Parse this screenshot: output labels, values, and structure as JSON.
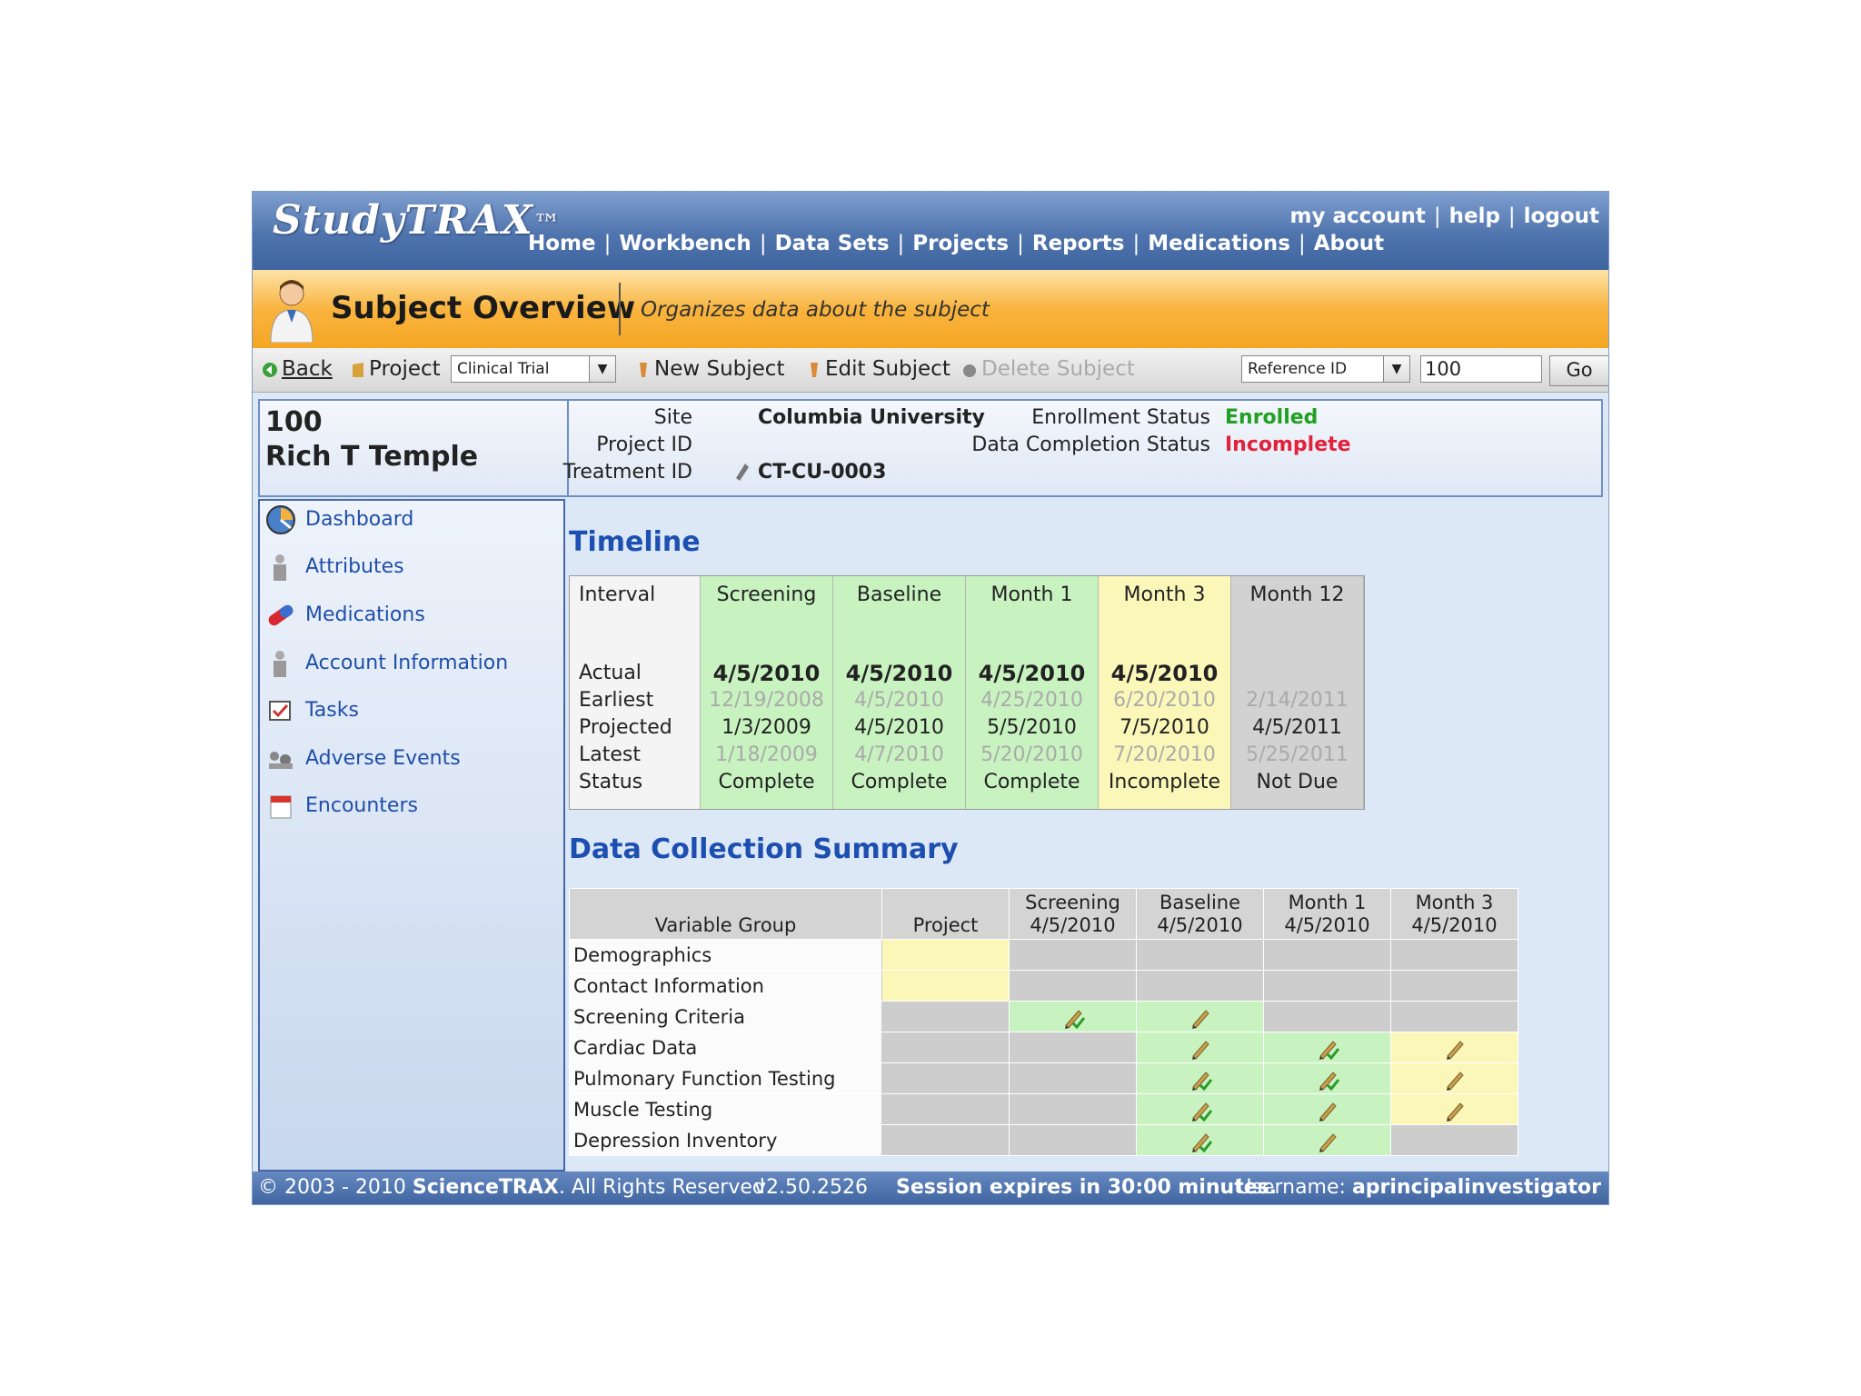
{
  "header": {
    "logo_text": "StudyTRAX",
    "logo_tm": "™",
    "nav": [
      "Home",
      "Workbench",
      "Data Sets",
      "Projects",
      "Reports",
      "Medications",
      "About"
    ],
    "user_nav": [
      "my account",
      "help",
      "logout"
    ],
    "colors": {
      "header": "#4f74ad",
      "title_bar": "#f9b43f"
    }
  },
  "title_bar": {
    "title": "Subject Overview",
    "subtitle": "Organizes data about the subject"
  },
  "toolbar": {
    "back": "Back",
    "project_label": "Project",
    "project_value": "Clinical Trial",
    "new_subject": "New Subject",
    "edit_subject": "Edit Subject",
    "delete_subject": "Delete Subject",
    "reference_select": "Reference ID",
    "reference_value": "100",
    "go": "Go"
  },
  "subject": {
    "id": "100",
    "name": "Rich T Temple",
    "site_label": "Site",
    "site": "Columbia University",
    "project_id_label": "Project ID",
    "project_id": "",
    "treatment_id_label": "Treatment ID",
    "treatment_id": "CT-CU-0003",
    "enrollment_label": "Enrollment Status",
    "enrollment": "Enrolled",
    "completion_label": "Data Completion Status",
    "completion": "Incomplete"
  },
  "sidebar": {
    "items": [
      {
        "label": "Dashboard",
        "icon": "dashboard-icon"
      },
      {
        "label": "Attributes",
        "icon": "attributes-icon"
      },
      {
        "label": "Medications",
        "icon": "pill-icon"
      },
      {
        "label": "Account Information",
        "icon": "account-icon"
      },
      {
        "label": "Tasks",
        "icon": "checkbox-icon"
      },
      {
        "label": "Adverse Events",
        "icon": "adverse-events-icon"
      },
      {
        "label": "Encounters",
        "icon": "calendar-icon"
      }
    ]
  },
  "timeline": {
    "title": "Timeline",
    "row_labels": [
      "Interval",
      "Actual",
      "Earliest",
      "Projected",
      "Latest",
      "Status"
    ],
    "columns": [
      {
        "interval": "Screening",
        "actual": "4/5/2010",
        "earliest": "12/19/2008",
        "projected": "1/3/2009",
        "latest": "1/18/2009",
        "status": "Complete",
        "color": "#c8f3c0"
      },
      {
        "interval": "Baseline",
        "actual": "4/5/2010",
        "earliest": "4/5/2010",
        "projected": "4/5/2010",
        "latest": "4/7/2010",
        "status": "Complete",
        "color": "#c8f3c0"
      },
      {
        "interval": "Month 1",
        "actual": "4/5/2010",
        "earliest": "4/25/2010",
        "projected": "5/5/2010",
        "latest": "5/20/2010",
        "status": "Complete",
        "color": "#c8f3c0"
      },
      {
        "interval": "Month 3",
        "actual": "4/5/2010",
        "earliest": "6/20/2010",
        "projected": "7/5/2010",
        "latest": "7/20/2010",
        "status": "Incomplete",
        "color": "#fbf7b8"
      },
      {
        "interval": "Month 12",
        "actual": "",
        "earliest": "2/14/2011",
        "projected": "4/5/2011",
        "latest": "5/25/2011",
        "status": "Not Due",
        "color": "#d2d2d2"
      }
    ]
  },
  "summary": {
    "title": "Data Collection Summary",
    "headers": [
      {
        "line1": "",
        "line2": "Variable Group"
      },
      {
        "line1": "",
        "line2": "Project"
      },
      {
        "line1": "Screening",
        "line2": "4/5/2010"
      },
      {
        "line1": "Baseline",
        "line2": "4/5/2010"
      },
      {
        "line1": "Month 1",
        "line2": "4/5/2010"
      },
      {
        "line1": "Month 3",
        "line2": "4/5/2010"
      }
    ],
    "rows": [
      {
        "label": "Demographics",
        "cells": [
          {
            "c": "yellow",
            "p": 0
          },
          {
            "c": "gray",
            "p": 0
          },
          {
            "c": "gray",
            "p": 0
          },
          {
            "c": "gray",
            "p": 0
          },
          {
            "c": "gray",
            "p": 0
          }
        ]
      },
      {
        "label": "Contact Information",
        "cells": [
          {
            "c": "yellow",
            "p": 0
          },
          {
            "c": "gray",
            "p": 0
          },
          {
            "c": "gray",
            "p": 0
          },
          {
            "c": "gray",
            "p": 0
          },
          {
            "c": "gray",
            "p": 0
          }
        ]
      },
      {
        "label": "Screening Criteria",
        "cells": [
          {
            "c": "gray",
            "p": 0
          },
          {
            "c": "green",
            "p": 2
          },
          {
            "c": "green",
            "p": 1
          },
          {
            "c": "gray",
            "p": 0
          },
          {
            "c": "gray",
            "p": 0
          }
        ]
      },
      {
        "label": "Cardiac Data",
        "cells": [
          {
            "c": "gray",
            "p": 0
          },
          {
            "c": "gray",
            "p": 0
          },
          {
            "c": "green",
            "p": 1
          },
          {
            "c": "green",
            "p": 2
          },
          {
            "c": "yellow",
            "p": 1
          }
        ]
      },
      {
        "label": "Pulmonary Function Testing",
        "cells": [
          {
            "c": "gray",
            "p": 0
          },
          {
            "c": "gray",
            "p": 0
          },
          {
            "c": "green",
            "p": 2
          },
          {
            "c": "green",
            "p": 2
          },
          {
            "c": "yellow",
            "p": 1
          }
        ]
      },
      {
        "label": "Muscle Testing",
        "cells": [
          {
            "c": "gray",
            "p": 0
          },
          {
            "c": "gray",
            "p": 0
          },
          {
            "c": "green",
            "p": 2
          },
          {
            "c": "green",
            "p": 1
          },
          {
            "c": "yellow",
            "p": 1
          }
        ]
      },
      {
        "label": "Depression Inventory",
        "cells": [
          {
            "c": "gray",
            "p": 0
          },
          {
            "c": "gray",
            "p": 0
          },
          {
            "c": "green",
            "p": 2
          },
          {
            "c": "green",
            "p": 1
          },
          {
            "c": "gray",
            "p": 0
          }
        ]
      }
    ]
  },
  "footer": {
    "copyright": "© 2003 - 2010",
    "company": "ScienceTRAX",
    "rights": ". All Rights Reserved",
    "version": "v2.50.2526",
    "session": "Session expires in 30:00 minutes.",
    "username_label": "Username:",
    "username": "aprincipalinvestigator"
  }
}
